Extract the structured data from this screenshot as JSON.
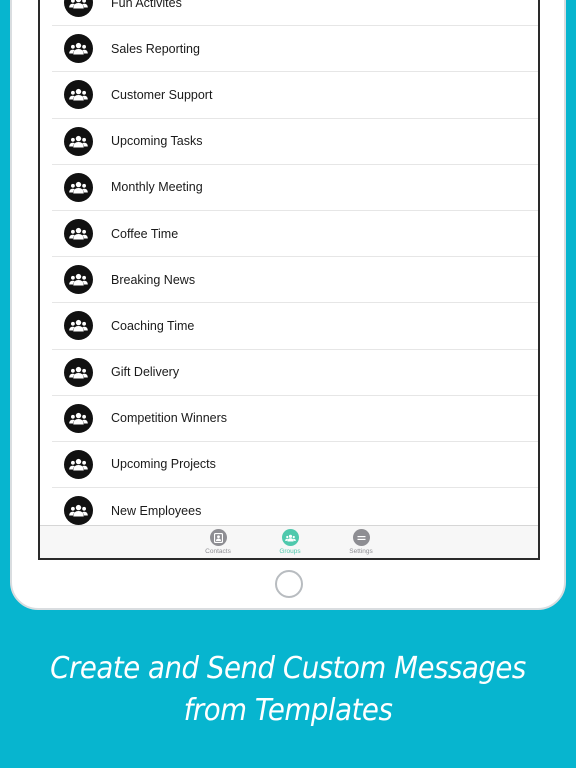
{
  "groups": {
    "items": [
      {
        "label": "Fun Activites"
      },
      {
        "label": "Sales Reporting"
      },
      {
        "label": "Customer Support"
      },
      {
        "label": "Upcoming Tasks"
      },
      {
        "label": "Monthly Meeting"
      },
      {
        "label": "Coffee Time"
      },
      {
        "label": "Breaking News"
      },
      {
        "label": "Coaching Time"
      },
      {
        "label": "Gift Delivery"
      },
      {
        "label": "Competition Winners"
      },
      {
        "label": "Upcoming Projects"
      },
      {
        "label": "New Employees"
      }
    ]
  },
  "tabbar": {
    "contacts_label": "Contacts",
    "groups_label": "Groups",
    "settings_label": "Settings",
    "active_tab": "groups",
    "active_color": "#4fc9ad",
    "inactive_color": "#8e8e93"
  },
  "caption": {
    "line1": "Create and Send Custom Messages",
    "line2": "from Templates"
  },
  "colors": {
    "background": "#07b5cf",
    "avatar": "#111111"
  },
  "icons": {
    "group_avatar": "group-icon",
    "contacts_tab": "contact-card-icon",
    "groups_tab": "group-icon",
    "settings_tab": "chat-bubble-icon"
  }
}
